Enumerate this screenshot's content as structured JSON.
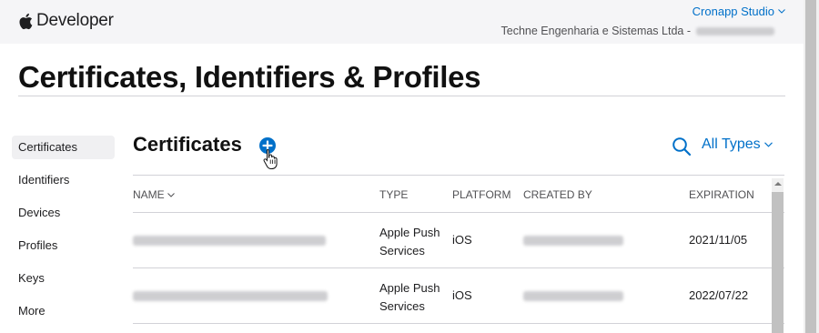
{
  "header": {
    "brand": "Developer",
    "team_menu": "Cronapp Studio",
    "team_name": "Techne Engenharia e Sistemas Ltda -"
  },
  "page_title": "Certificates, Identifiers & Profiles",
  "sidebar": {
    "items": [
      {
        "label": "Certificates",
        "active": true
      },
      {
        "label": "Identifiers"
      },
      {
        "label": "Devices"
      },
      {
        "label": "Profiles"
      },
      {
        "label": "Keys"
      },
      {
        "label": "More"
      }
    ]
  },
  "section": {
    "title": "Certificates",
    "filter_label": "All Types"
  },
  "table": {
    "headers": {
      "name": "NAME",
      "type": "TYPE",
      "platform": "PLATFORM",
      "created_by": "CREATED BY",
      "expiration": "EXPIRATION"
    },
    "rows": [
      {
        "type_line1": "Apple Push",
        "type_line2": "Services",
        "platform": "iOS",
        "expiration": "2021/11/05"
      },
      {
        "type_line1": "Apple Push",
        "type_line2": "Services",
        "platform": "iOS",
        "expiration": "2022/07/22"
      }
    ]
  },
  "colors": {
    "accent": "#0070c9",
    "text": "#1d1d1f",
    "divider": "#d2d2d7"
  }
}
